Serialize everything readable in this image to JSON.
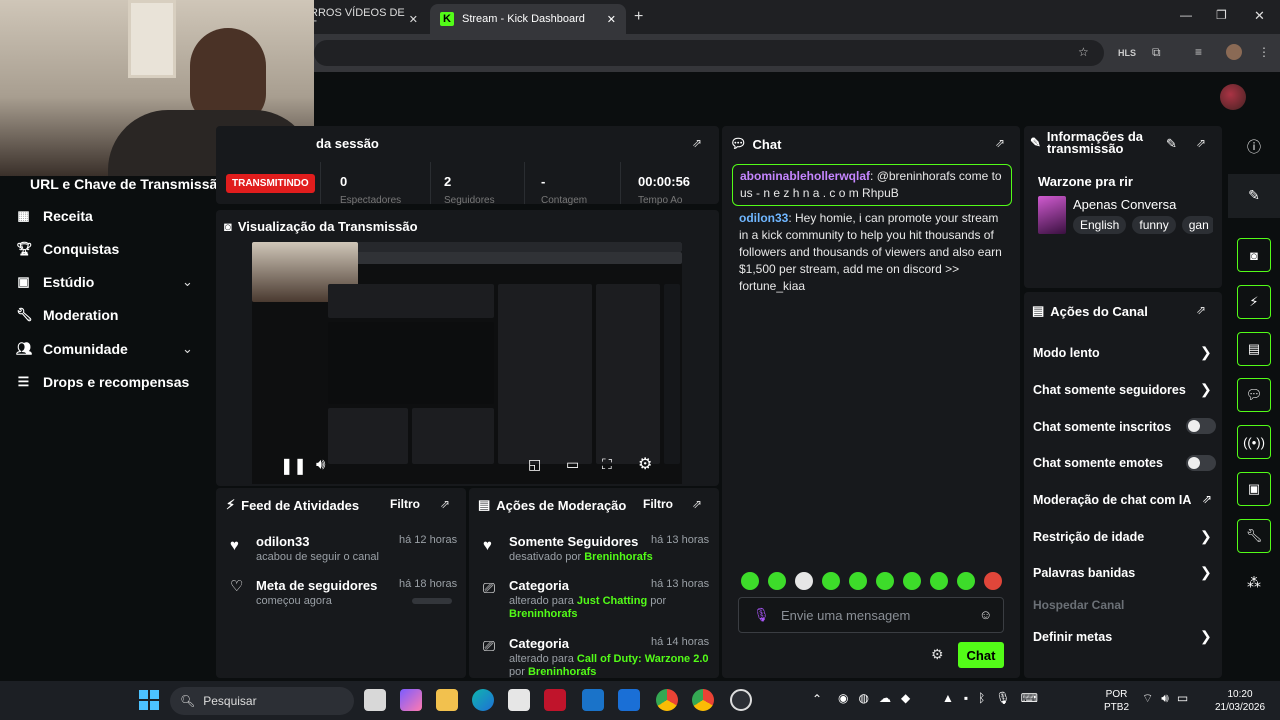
{
  "browser": {
    "tab1_label": "RROS VÍDEOS DE T",
    "tab2_label": "Stream - Kick Dashboard",
    "hls_label": "HLS"
  },
  "sidebar": {
    "url_key_label": "URL e Chave de Transmissão",
    "items": [
      {
        "label": "Receita"
      },
      {
        "label": "Conquistas"
      },
      {
        "label": "Estúdio"
      },
      {
        "label": "Moderation"
      },
      {
        "label": "Comunidade"
      },
      {
        "label": "Drops e recompensas"
      }
    ]
  },
  "session": {
    "title": "da sessão",
    "status": "TRANSMITINDO",
    "stats": [
      {
        "value": "0",
        "label": "Espectadores"
      },
      {
        "value": "2",
        "label": "Seguidores"
      },
      {
        "value": "-",
        "label": "Contagem"
      },
      {
        "value": "00:00:56",
        "label": "Tempo Ao"
      }
    ]
  },
  "preview": {
    "title": "Visualização da Transmissão"
  },
  "activity": {
    "title": "Feed de Atividades",
    "filter": "Filtro",
    "items": [
      {
        "name": "odilon33",
        "desc": "acabou de seguir o canal",
        "time": "há 12 horas"
      },
      {
        "name": "Meta de seguidores",
        "desc": "começou agora",
        "time": "há 18 horas"
      }
    ]
  },
  "moderation": {
    "title": "Ações de Moderação",
    "filter": "Filtro",
    "items": [
      {
        "name": "Somente Seguidores",
        "desc_prefix": "desativado por",
        "actor": "Breninhorafs",
        "time": "há 13 horas"
      },
      {
        "name": "Categoria",
        "desc_prefix": "alterado para",
        "value": "Just Chatting",
        "by": "por",
        "actor": "Breninhorafs",
        "time": "há 13 horas"
      },
      {
        "name": "Categoria",
        "desc_prefix": "alterado para",
        "value": "Call of Duty: Warzone 2.0",
        "by": "por",
        "actor": "Breninhorafs",
        "time": "há 14 horas"
      }
    ]
  },
  "chat": {
    "title": "Chat",
    "messages": [
      {
        "user": "abominablehollerwqlaf",
        "text": ": @breninhorafs come to us - n e z h n a . c o m RhpuB"
      },
      {
        "user": "odilon33",
        "text": ": Hey homie, i can promote your stream in a kick community to help you hit thousands of followers and thousands of viewers and also earn $1,500 per stream, add me on discord >> fortune_kiaa"
      }
    ],
    "placeholder": "Envie uma mensagem",
    "send_label": "Chat"
  },
  "info": {
    "title": "Informações da transmissão",
    "stream_title": "Warzone pra rir",
    "category": "Apenas Conversa",
    "tags": [
      "English",
      "funny",
      "gan"
    ]
  },
  "channel_actions": {
    "title": "Ações do Canal",
    "rows": [
      {
        "label": "Modo lento",
        "control": "chevron"
      },
      {
        "label": "Chat somente seguidores",
        "control": "chevron"
      },
      {
        "label": "Chat somente inscritos",
        "control": "toggle"
      },
      {
        "label": "Chat somente emotes",
        "control": "toggle"
      },
      {
        "label": "Moderação de chat com IA",
        "control": "external"
      },
      {
        "label": "Restrição de idade",
        "control": "chevron"
      },
      {
        "label": "Palavras banidas",
        "control": "chevron"
      }
    ],
    "host_label": "Hospedar Canal",
    "goals_label": "Definir metas"
  },
  "taskbar": {
    "search_label": "Pesquisar",
    "lang_line1": "POR",
    "lang_line2": "PTB2",
    "time": "10:20",
    "date": "21/03/2026"
  },
  "colors": {
    "accent": "#53fc18",
    "live": "#e11d1d",
    "panel": "#17191c",
    "background": "#0b0e0f"
  }
}
